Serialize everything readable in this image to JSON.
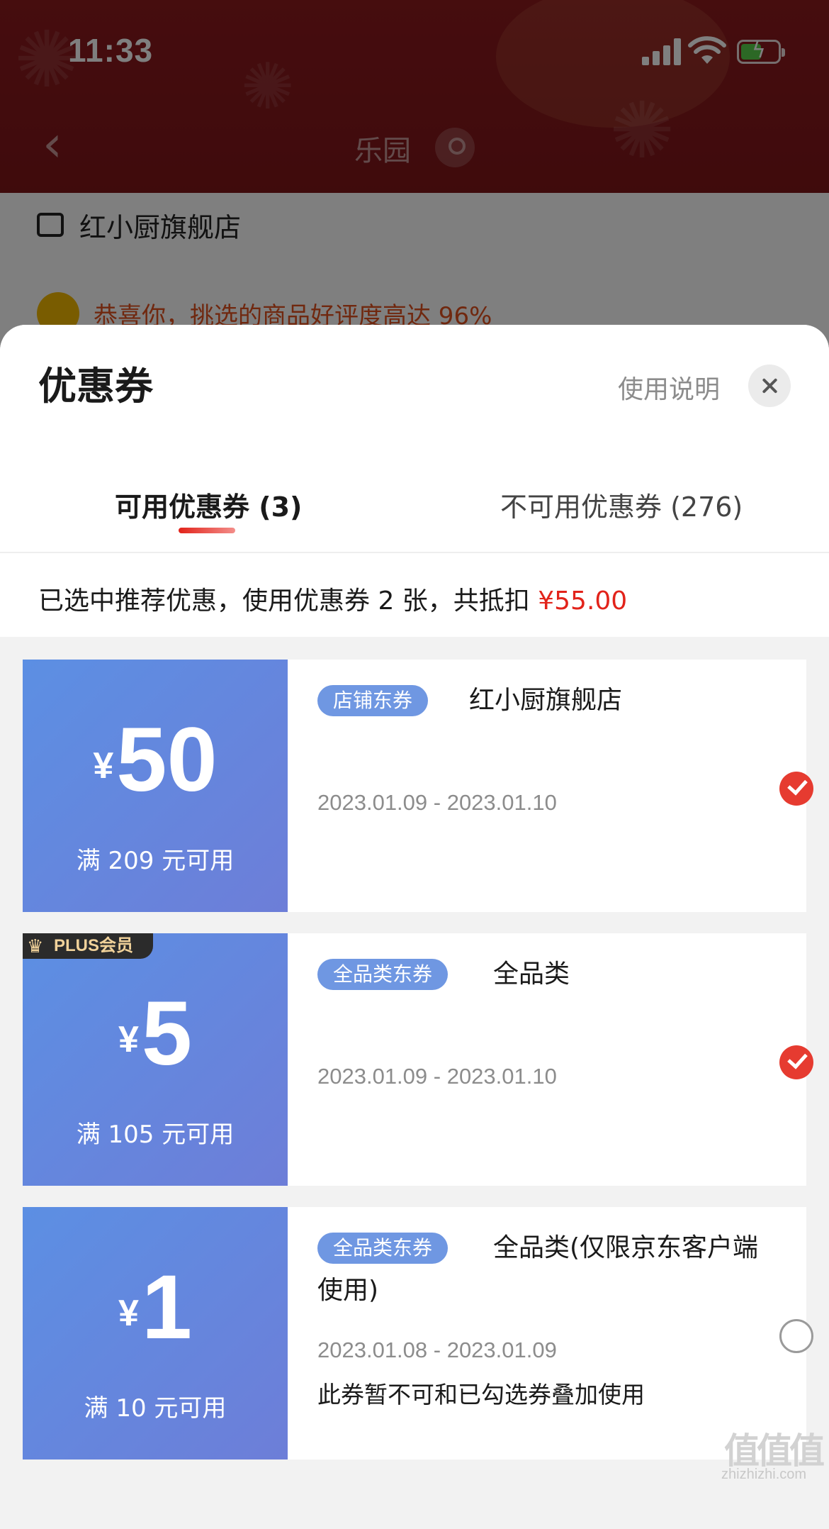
{
  "status_bar": {
    "time": "11:33"
  },
  "background_page": {
    "nav_title": "乐园",
    "store_name": "红小厨旗舰店",
    "praise_text": "恭喜你，挑选的商品好评度高达 96%"
  },
  "sheet": {
    "title": "优惠券",
    "help_label": "使用说明",
    "tabs": [
      {
        "label": "可用优惠券 (3)",
        "active": true
      },
      {
        "label": "不可用优惠券 (276)",
        "active": false
      }
    ],
    "summary_prefix": "已选中推荐优惠，使用优惠券 2 张，共抵扣 ",
    "summary_amount": "¥55.00"
  },
  "coupons": [
    {
      "currency": "¥",
      "amount": "50",
      "threshold": "满 209 元可用",
      "tag": "店铺东券",
      "name": "红小厨旗舰店",
      "date_range": "2023.01.09 - 2023.01.10",
      "selected": true
    },
    {
      "badge": "PLUS会员",
      "currency": "¥",
      "amount": "5",
      "threshold": "满 105 元可用",
      "tag": "全品类东券",
      "name": "全品类",
      "date_range": "2023.01.09 - 2023.01.10",
      "selected": true
    },
    {
      "currency": "¥",
      "amount": "1",
      "threshold": "满 10 元可用",
      "tag": "全品类东券",
      "name_line1": "全品类(仅限京东客户端",
      "name_line2": "使用)",
      "date_range": "2023.01.08 - 2023.01.09",
      "restriction": "此券暂不可和已勾选券叠加使用",
      "selected": false
    }
  ],
  "watermark": "zhizhizhi.com",
  "colors": {
    "accent": "#e2231a",
    "coupon_blue": "#6a86dd",
    "check_red": "#e63b30"
  }
}
